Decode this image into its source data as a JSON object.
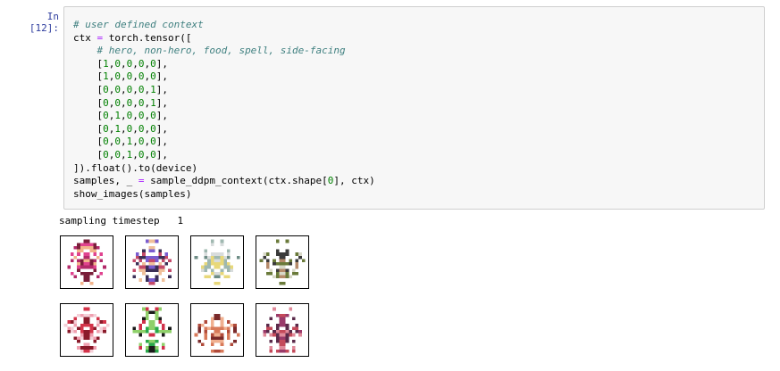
{
  "cell": {
    "prompt": "In [12]:",
    "code_lines": [
      [
        {
          "t": "# user defined context",
          "c": "comment"
        }
      ],
      [
        {
          "t": "ctx ",
          "c": ""
        },
        {
          "t": "=",
          "c": "op"
        },
        {
          "t": " torch.tensor([",
          "c": ""
        }
      ],
      [
        {
          "t": "    ",
          "c": ""
        },
        {
          "t": "# hero, non-hero, food, spell, side-facing",
          "c": "comment"
        }
      ],
      [
        {
          "t": "    [",
          "c": ""
        },
        {
          "t": "1",
          "c": "num"
        },
        {
          "t": ",",
          "c": ""
        },
        {
          "t": "0",
          "c": "num"
        },
        {
          "t": ",",
          "c": ""
        },
        {
          "t": "0",
          "c": "num"
        },
        {
          "t": ",",
          "c": ""
        },
        {
          "t": "0",
          "c": "num"
        },
        {
          "t": ",",
          "c": ""
        },
        {
          "t": "0",
          "c": "num"
        },
        {
          "t": "],",
          "c": ""
        }
      ],
      [
        {
          "t": "    [",
          "c": ""
        },
        {
          "t": "1",
          "c": "num"
        },
        {
          "t": ",",
          "c": ""
        },
        {
          "t": "0",
          "c": "num"
        },
        {
          "t": ",",
          "c": ""
        },
        {
          "t": "0",
          "c": "num"
        },
        {
          "t": ",",
          "c": ""
        },
        {
          "t": "0",
          "c": "num"
        },
        {
          "t": ",",
          "c": ""
        },
        {
          "t": "0",
          "c": "num"
        },
        {
          "t": "],",
          "c": ""
        }
      ],
      [
        {
          "t": "    [",
          "c": ""
        },
        {
          "t": "0",
          "c": "num"
        },
        {
          "t": ",",
          "c": ""
        },
        {
          "t": "0",
          "c": "num"
        },
        {
          "t": ",",
          "c": ""
        },
        {
          "t": "0",
          "c": "num"
        },
        {
          "t": ",",
          "c": ""
        },
        {
          "t": "0",
          "c": "num"
        },
        {
          "t": ",",
          "c": ""
        },
        {
          "t": "1",
          "c": "num"
        },
        {
          "t": "],",
          "c": ""
        }
      ],
      [
        {
          "t": "    [",
          "c": ""
        },
        {
          "t": "0",
          "c": "num"
        },
        {
          "t": ",",
          "c": ""
        },
        {
          "t": "0",
          "c": "num"
        },
        {
          "t": ",",
          "c": ""
        },
        {
          "t": "0",
          "c": "num"
        },
        {
          "t": ",",
          "c": ""
        },
        {
          "t": "0",
          "c": "num"
        },
        {
          "t": ",",
          "c": ""
        },
        {
          "t": "1",
          "c": "num"
        },
        {
          "t": "],",
          "c": ""
        }
      ],
      [
        {
          "t": "    [",
          "c": ""
        },
        {
          "t": "0",
          "c": "num"
        },
        {
          "t": ",",
          "c": ""
        },
        {
          "t": "1",
          "c": "num"
        },
        {
          "t": ",",
          "c": ""
        },
        {
          "t": "0",
          "c": "num"
        },
        {
          "t": ",",
          "c": ""
        },
        {
          "t": "0",
          "c": "num"
        },
        {
          "t": ",",
          "c": ""
        },
        {
          "t": "0",
          "c": "num"
        },
        {
          "t": "],",
          "c": ""
        }
      ],
      [
        {
          "t": "    [",
          "c": ""
        },
        {
          "t": "0",
          "c": "num"
        },
        {
          "t": ",",
          "c": ""
        },
        {
          "t": "1",
          "c": "num"
        },
        {
          "t": ",",
          "c": ""
        },
        {
          "t": "0",
          "c": "num"
        },
        {
          "t": ",",
          "c": ""
        },
        {
          "t": "0",
          "c": "num"
        },
        {
          "t": ",",
          "c": ""
        },
        {
          "t": "0",
          "c": "num"
        },
        {
          "t": "],",
          "c": ""
        }
      ],
      [
        {
          "t": "    [",
          "c": ""
        },
        {
          "t": "0",
          "c": "num"
        },
        {
          "t": ",",
          "c": ""
        },
        {
          "t": "0",
          "c": "num"
        },
        {
          "t": ",",
          "c": ""
        },
        {
          "t": "1",
          "c": "num"
        },
        {
          "t": ",",
          "c": ""
        },
        {
          "t": "0",
          "c": "num"
        },
        {
          "t": ",",
          "c": ""
        },
        {
          "t": "0",
          "c": "num"
        },
        {
          "t": "],",
          "c": ""
        }
      ],
      [
        {
          "t": "    [",
          "c": ""
        },
        {
          "t": "0",
          "c": "num"
        },
        {
          "t": ",",
          "c": ""
        },
        {
          "t": "0",
          "c": "num"
        },
        {
          "t": ",",
          "c": ""
        },
        {
          "t": "1",
          "c": "num"
        },
        {
          "t": ",",
          "c": ""
        },
        {
          "t": "0",
          "c": "num"
        },
        {
          "t": ",",
          "c": ""
        },
        {
          "t": "0",
          "c": "num"
        },
        {
          "t": "],",
          "c": ""
        }
      ],
      [
        {
          "t": "]).float().to(device)",
          "c": ""
        }
      ],
      [
        {
          "t": "samples, _ ",
          "c": ""
        },
        {
          "t": "=",
          "c": "op"
        },
        {
          "t": " sample_ddpm_context(ctx.shape[",
          "c": ""
        },
        {
          "t": "0",
          "c": "num"
        },
        {
          "t": "], ctx)",
          "c": ""
        }
      ],
      [
        {
          "t": "show_images(samples)",
          "c": ""
        }
      ]
    ],
    "output_text": "sampling timestep   1"
  },
  "colors": {
    "prompt": "#303f9f",
    "comment": "#408080",
    "number": "#008000",
    "operator": "#aa22ff",
    "cell_bg": "#f7f7f7"
  },
  "images": [
    {
      "name": "sprite-hero-pink",
      "palette": [
        "#e0438f",
        "#b32a6a",
        "#f2b48c",
        "#7a1f3a"
      ]
    },
    {
      "name": "sprite-hero-purple",
      "palette": [
        "#7a5ccf",
        "#c44a6a",
        "#f0c09a",
        "#3b2f55"
      ]
    },
    {
      "name": "sprite-side-white",
      "palette": [
        "#d8dcdc",
        "#9fb8b0",
        "#6e8d86",
        "#e8d87a"
      ]
    },
    {
      "name": "sprite-side-dark",
      "palette": [
        "#3a3a3a",
        "#6a7a3a",
        "#b58a6a",
        "#d8d8c8"
      ]
    },
    {
      "name": "sprite-nonhero-red",
      "palette": [
        "#d3344a",
        "#f0a0b0",
        "#8a1a2a",
        "#f4d0d8"
      ]
    },
    {
      "name": "sprite-nonhero-green",
      "palette": [
        "#2aa84a",
        "#d0304a",
        "#1a1a1a",
        "#8fd06a"
      ]
    },
    {
      "name": "sprite-food-orange",
      "palette": [
        "#d87a5a",
        "#b04a3a",
        "#f0b090",
        "#7a2a2a"
      ]
    },
    {
      "name": "sprite-food-purple",
      "palette": [
        "#9a3a6a",
        "#c44a5a",
        "#e08a9a",
        "#5a2a4a"
      ]
    }
  ]
}
